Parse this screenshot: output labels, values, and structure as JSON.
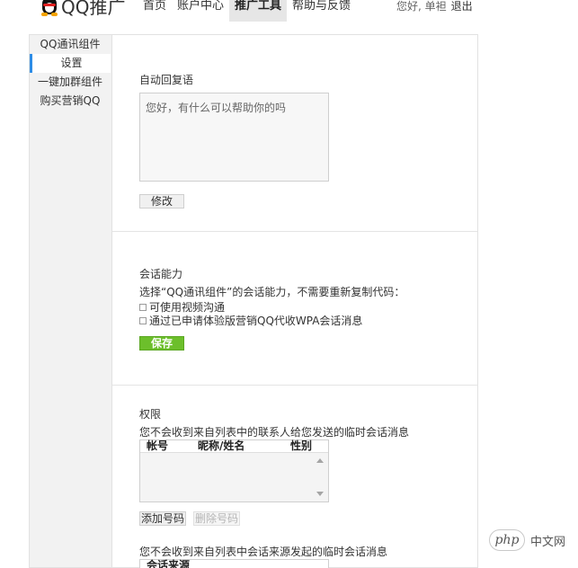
{
  "header": {
    "logo_text": "QQ推广",
    "nav": [
      "首页",
      "账户中心",
      "推广工具",
      "帮助与反馈"
    ],
    "active_nav": "推广工具",
    "user_text": "您好, 单袒",
    "logout": "退出"
  },
  "sidebar": {
    "items": [
      {
        "label": "QQ通讯组件"
      },
      {
        "label": "设置"
      },
      {
        "label": "一键加群组件"
      },
      {
        "label": "购买营销QQ"
      }
    ],
    "active": "设置"
  },
  "auto_reply": {
    "title": "自动回复语",
    "text": "您好，有什么可以帮助你的吗",
    "edit_button": "修改"
  },
  "capability": {
    "title": "会话能力",
    "description": "选择“QQ通讯组件”的会话能力，不需要重新复制代码：",
    "options": [
      {
        "label": "可使用视频沟通",
        "checked": false
      },
      {
        "label": "通过已申请体验版营销QQ代收WPA会话消息",
        "checked": false
      }
    ],
    "save_button": "保存"
  },
  "permission": {
    "title": "权限",
    "desc_contacts": "您不会收到来自列表中的联系人给您发送的临时会话消息",
    "columns": [
      "帐号",
      "昵称/姓名",
      "性别"
    ],
    "add_button": "添加号码",
    "delete_button": "删除号码",
    "desc_sources": "您不会收到来自列表中会话来源发起的临时会话消息",
    "source_column": "会话来源"
  },
  "watermark": {
    "badge": "php",
    "text": "中文网"
  }
}
